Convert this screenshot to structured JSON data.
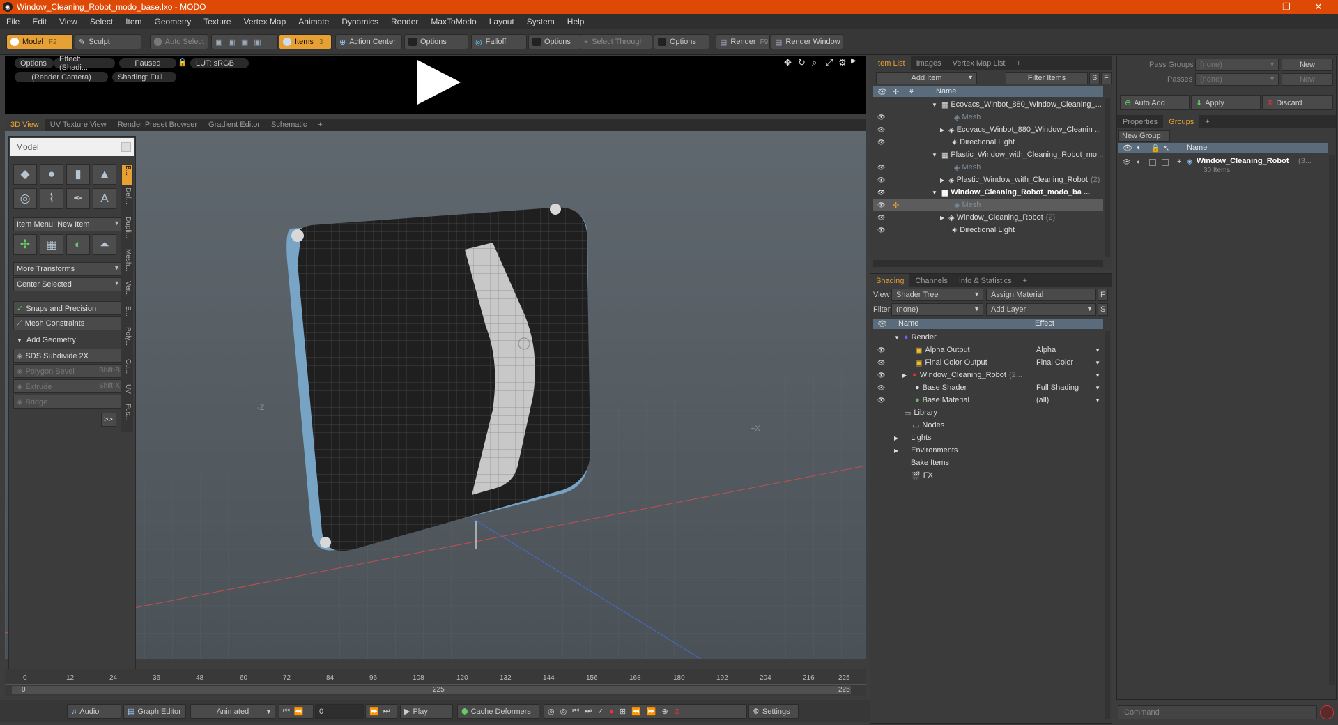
{
  "window": {
    "title": "Window_Cleaning_Robot_modo_base.lxo - MODO",
    "minimize": "–",
    "maximize": "❐",
    "close": "✕"
  },
  "menu": [
    "File",
    "Edit",
    "View",
    "Select",
    "Item",
    "Geometry",
    "Texture",
    "Vertex Map",
    "Animate",
    "Dynamics",
    "Render",
    "MaxToModo",
    "Layout",
    "System",
    "Help"
  ],
  "toolbar": {
    "model": "Model",
    "model_key": "F2",
    "sculpt": "Sculpt",
    "auto_select": "Auto Select",
    "items": "Items",
    "items_key": "3",
    "action_center": "Action Center",
    "options1": "Options",
    "falloff": "Falloff",
    "options2": "Options",
    "select_through": "Select Through",
    "options3": "Options",
    "render": "Render",
    "render_key": "F9",
    "render_window": "Render Window"
  },
  "preview": {
    "options": "Options",
    "effect": "Effect: (Shadi...",
    "paused": "Paused",
    "lut": "LUT: sRGB",
    "camera": "(Render Camera)",
    "shading": "Shading: Full"
  },
  "viewport_tabs": [
    "3D View",
    "UV Texture View",
    "Render Preset Browser",
    "Gradient Editor",
    "Schematic",
    "+"
  ],
  "model_panel": {
    "title": "Model",
    "item_menu": "Item Menu: New Item",
    "more_transforms": "More Transforms",
    "center_selected": "Center Selected",
    "snaps": "Snaps and Precision",
    "mesh_constraints": "Mesh Constraints",
    "add_geometry": "Add Geometry",
    "sds": "SDS Subdivide 2X",
    "polygon_bevel": "Polygon Bevel",
    "polygon_bevel_key": "Shift-B",
    "extrude": "Extrude",
    "extrude_key": "Shift-X",
    "bridge": "Bridge",
    "expand": ">>",
    "vtabs": [
      "B...",
      "Def...",
      "Dupli...",
      "Mesh...",
      "Ver...",
      "E...",
      "Poly...",
      "Cu...",
      "UV",
      "Fus..."
    ]
  },
  "viewport": {
    "axis_z": "-Z",
    "axis_x": "+X"
  },
  "timeline": {
    "ticks": [
      "0",
      "12",
      "24",
      "36",
      "48",
      "60",
      "72",
      "84",
      "96",
      "108",
      "120",
      "132",
      "144",
      "156",
      "168",
      "180",
      "192",
      "204",
      "216",
      "225"
    ],
    "sub_left": "0",
    "sub_mid": "225",
    "sub_right": "225"
  },
  "bottom": {
    "audio": "Audio",
    "graph_editor": "Graph Editor",
    "animated": "Animated",
    "frame": "0",
    "play": "Play",
    "cache_deformers": "Cache Deformers",
    "settings": "Settings"
  },
  "item_list": {
    "tabs": [
      "Item List",
      "Images",
      "Vertex Map List",
      "+"
    ],
    "add_item": "Add Item",
    "filter_items": "Filter Items",
    "s": "S",
    "f": "F",
    "name_col": "Name",
    "rows": [
      {
        "label": "Ecovacs_Winbot_880_Window_Cleaning_...",
        "indent": 0
      },
      {
        "label": "Mesh",
        "indent": 2
      },
      {
        "label": "Ecovacs_Winbot_880_Window_Cleanin ...",
        "indent": 1
      },
      {
        "label": "Directional Light",
        "indent": 1
      },
      {
        "label": "Plastic_Window_with_Cleaning_Robot_mo...",
        "indent": 0
      },
      {
        "label": "Mesh",
        "indent": 2
      },
      {
        "label": "Plastic_Window_with_Cleaning_Robot",
        "count": "(2)",
        "indent": 1
      },
      {
        "label": "Window_Cleaning_Robot_modo_ba ...",
        "indent": 0
      },
      {
        "label": "Mesh",
        "indent": 2
      },
      {
        "label": "Window_Cleaning_Robot",
        "count": "(2)",
        "indent": 1
      },
      {
        "label": "Directional Light",
        "indent": 1
      }
    ]
  },
  "shading": {
    "tabs": [
      "Shading",
      "Channels",
      "Info & Statistics",
      "+"
    ],
    "view_label": "View",
    "view_value": "Shader Tree",
    "assign_material": "Assign Material",
    "f": "F",
    "filter_label": "Filter",
    "filter_value": "(none)",
    "add_layer": "Add Layer",
    "s": "S",
    "name_col": "Name",
    "effect_col": "Effect",
    "rows": [
      {
        "label": "Render",
        "effect": ""
      },
      {
        "label": "Alpha Output",
        "effect": "Alpha"
      },
      {
        "label": "Final Color Output",
        "effect": "Final Color"
      },
      {
        "label": "Window_Cleaning_Robot",
        "count": "(2...",
        "effect": ""
      },
      {
        "label": "Base Shader",
        "effect": "Full Shading"
      },
      {
        "label": "Base Material",
        "effect": "(all)"
      },
      {
        "label": "Library",
        "effect": ""
      },
      {
        "label": "Nodes",
        "effect": ""
      },
      {
        "label": "Lights",
        "effect": ""
      },
      {
        "label": "Environments",
        "effect": ""
      },
      {
        "label": "Bake Items",
        "effect": ""
      },
      {
        "label": "FX",
        "effect": ""
      }
    ]
  },
  "groups": {
    "pass_groups_label": "Pass Groups",
    "pass_groups_value": "(none)",
    "new": "New",
    "passes_label": "Passes",
    "passes_value": "(none)",
    "new2": "New",
    "auto_add": "Auto Add",
    "apply": "Apply",
    "discard": "Discard",
    "tabs": [
      "Properties",
      "Groups",
      "+"
    ],
    "new_group": "New Group",
    "name_col": "Name",
    "row_label": "Window_Cleaning_Robot",
    "row_count": "(3...",
    "row_sub": "30 Items"
  },
  "command": {
    "placeholder": "Command"
  }
}
